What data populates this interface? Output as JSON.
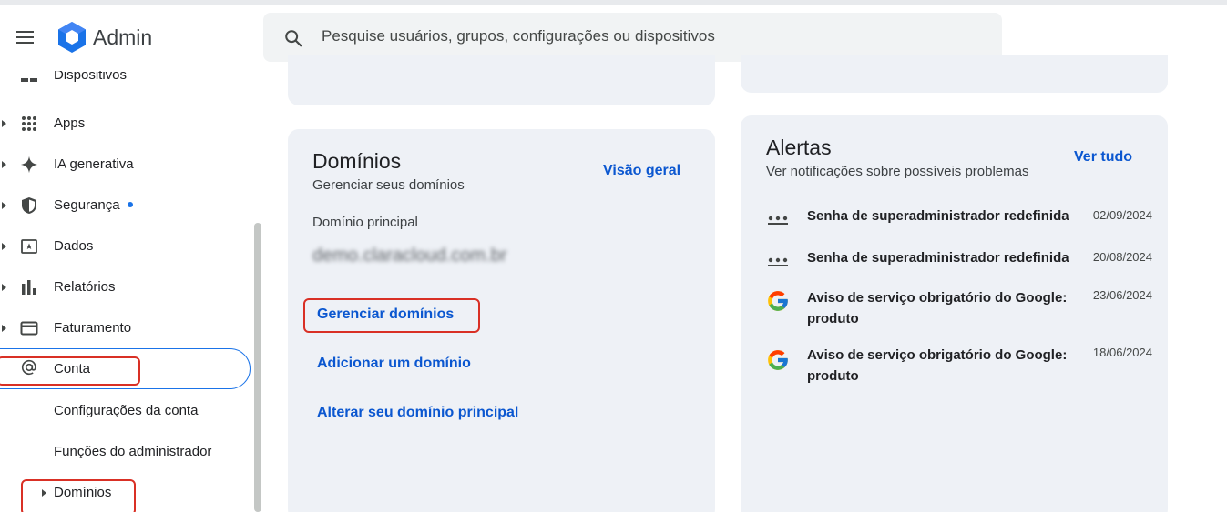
{
  "app": {
    "title": "Admin"
  },
  "search": {
    "placeholder": "Pesquise usuários, grupos, configurações ou dispositivos"
  },
  "sidebar": {
    "cut_item": "Dispositivos",
    "items": [
      {
        "label": "Apps",
        "icon": "apps-grid-icon"
      },
      {
        "label": "IA generativa",
        "icon": "sparkle-icon"
      },
      {
        "label": "Segurança",
        "icon": "shield-icon"
      },
      {
        "label": "Dados",
        "icon": "data-folder-icon"
      },
      {
        "label": "Relatórios",
        "icon": "bar-chart-icon"
      },
      {
        "label": "Faturamento",
        "icon": "credit-card-icon"
      },
      {
        "label": "Conta",
        "icon": "at-sign-icon"
      }
    ],
    "sub_items": [
      {
        "label": "Configurações da conta"
      },
      {
        "label": "Funções do administrador"
      },
      {
        "label": "Domínios"
      }
    ]
  },
  "domains_card": {
    "title": "Domínios",
    "subtitle": "Gerenciar seus domínios",
    "overview_link": "Visão geral",
    "primary_label": "Domínio principal",
    "primary_value": "demo.claracloud.com.br",
    "links": [
      "Gerenciar domínios",
      "Adicionar um domínio",
      "Alterar seu domínio principal"
    ]
  },
  "alerts_card": {
    "title": "Alertas",
    "subtitle": "Ver notificações sobre possíveis problemas",
    "see_all": "Ver tudo",
    "items": [
      {
        "icon": "dots-icon",
        "text": "Senha de superadministrador redefinida",
        "date": "02/09/2024"
      },
      {
        "icon": "dots-icon",
        "text": "Senha de superadministrador redefinida",
        "date": "20/08/2024"
      },
      {
        "icon": "google-icon",
        "text": "Aviso de serviço obrigatório do Google: produto",
        "date": "23/06/2024"
      },
      {
        "icon": "google-icon",
        "text": "Aviso de serviço obrigatório do Google: produto",
        "date": "18/06/2024"
      }
    ]
  },
  "colors": {
    "accent": "#0b57d0",
    "highlight": "#d93025",
    "card_bg": "#eef1f6"
  }
}
